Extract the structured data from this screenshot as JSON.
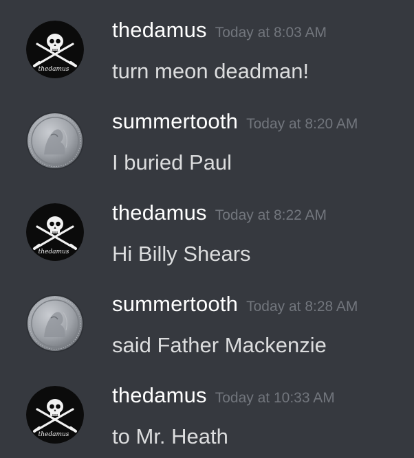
{
  "messages": [
    {
      "username": "thedamus",
      "timestamp": "Today at 8:03 AM",
      "text": "turn meon deadman!",
      "avatar_text": "thedamus",
      "avatar": "pirate-flag"
    },
    {
      "username": "summertooth",
      "timestamp": "Today at 8:20 AM",
      "text": "I buried Paul",
      "avatar": "silver-coin"
    },
    {
      "username": "thedamus",
      "timestamp": "Today at 8:22 AM",
      "text": "Hi Billy Shears",
      "avatar_text": "thedamus",
      "avatar": "pirate-flag"
    },
    {
      "username": "summertooth",
      "timestamp": "Today at 8:28 AM",
      "text": "said Father Mackenzie",
      "avatar": "silver-coin"
    },
    {
      "username": "thedamus",
      "timestamp": "Today at 10:33 AM",
      "text": "to Mr. Heath",
      "avatar_text": "thedamus",
      "avatar": "pirate-flag"
    }
  ],
  "colors": {
    "background": "#36393f",
    "username": "#ffffff",
    "timestamp": "#72767d",
    "text": "#dcddde"
  }
}
